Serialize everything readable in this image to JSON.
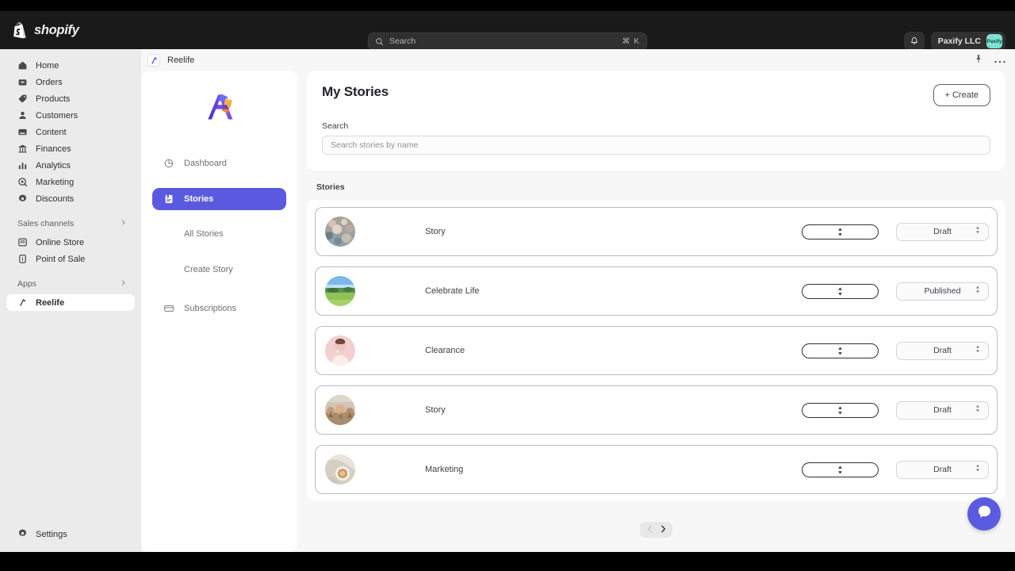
{
  "topbar": {
    "brand": "shopify",
    "brand_logo_icon": "shopify-bag-icon",
    "search": {
      "placeholder": "Search",
      "shortcut": "⌘ K",
      "icon": "search-icon"
    },
    "notifications_icon": "bell-icon",
    "user": {
      "name": "Paxify LLC",
      "avatar_text": "Paxify",
      "avatar_color": "#7ee0d0"
    }
  },
  "sidebar": {
    "items": [
      {
        "label": "Home",
        "icon": "home-icon"
      },
      {
        "label": "Orders",
        "icon": "orders-inbox-icon"
      },
      {
        "label": "Products",
        "icon": "tag-icon"
      },
      {
        "label": "Customers",
        "icon": "person-icon"
      },
      {
        "label": "Content",
        "icon": "content-image-icon"
      },
      {
        "label": "Finances",
        "icon": "bank-icon"
      },
      {
        "label": "Analytics",
        "icon": "bar-chart-icon"
      },
      {
        "label": "Marketing",
        "icon": "megaphone-target-icon"
      },
      {
        "label": "Discounts",
        "icon": "discount-gear-icon"
      }
    ],
    "groups": [
      {
        "title": "Sales channels",
        "chevron_icon": "chevron-right-icon",
        "items": [
          {
            "label": "Online Store",
            "icon": "online-store-icon"
          },
          {
            "label": "Point of Sale",
            "icon": "point-of-sale-icon"
          }
        ]
      },
      {
        "title": "Apps",
        "chevron_icon": "chevron-right-icon",
        "items": [
          {
            "label": "Reelife",
            "icon": "reelife-icon",
            "active": true
          }
        ]
      }
    ],
    "settings": {
      "label": "Settings",
      "icon": "gear-icon"
    }
  },
  "app_header": {
    "title": "Reelife",
    "app_icon": "reelife-icon",
    "pin_icon": "pin-icon",
    "more_icon": "ellipsis-icon"
  },
  "app_sidebar": {
    "logo_icon": "reelife-logo",
    "items": [
      {
        "label": "Dashboard",
        "icon": "pie-chart-icon",
        "type": "item",
        "active": false
      },
      {
        "label": "Stories",
        "icon": "stories-book-icon",
        "type": "item",
        "active": true
      },
      {
        "label": "All Stories",
        "type": "sub"
      },
      {
        "label": "Create Story",
        "type": "sub"
      },
      {
        "label": "Subscriptions",
        "icon": "credit-card-icon",
        "type": "item",
        "active": false
      }
    ],
    "active_color": "#5a5ae0"
  },
  "main": {
    "page_title": "My Stories",
    "create_button": "+ Create",
    "search_label": "Search",
    "search_placeholder": "Search stories by name",
    "section_label": "Stories",
    "rows": [
      {
        "name": "Story",
        "status": "Draft",
        "group": "",
        "thumb": "pebbles-beach-thumb"
      },
      {
        "name": "Celebrate Life",
        "status": "Published",
        "group": "",
        "thumb": "green-landscape-thumb"
      },
      {
        "name": "Clearance",
        "status": "Draft",
        "group": "",
        "thumb": "pink-portrait-thumb"
      },
      {
        "name": "Story",
        "status": "Draft",
        "group": "",
        "thumb": "crowd-cheers-thumb"
      },
      {
        "name": "Marketing",
        "status": "Draft",
        "group": "",
        "thumb": "latte-cup-thumb"
      }
    ],
    "pagination": {
      "prev_icon": "chevron-left-icon",
      "next_icon": "chevron-right-icon"
    },
    "chat_icon": "chat-bubble-icon"
  }
}
